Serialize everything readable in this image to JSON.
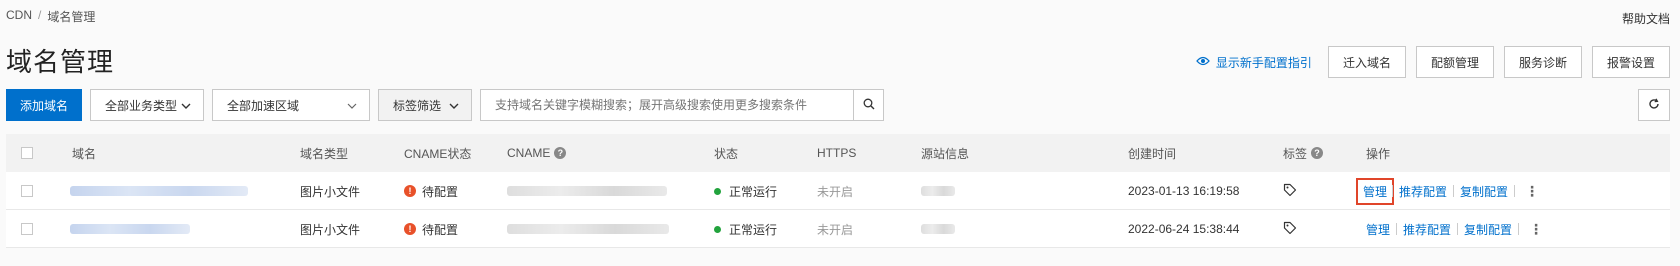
{
  "breadcrumb": {
    "root": "CDN",
    "separator": "/",
    "current": "域名管理"
  },
  "help_label": "帮助文档",
  "page_title": "域名管理",
  "top_actions": {
    "guide_label": "显示新手配置指引",
    "buttons": [
      "迁入域名",
      "配额管理",
      "服务诊断",
      "报警设置"
    ]
  },
  "toolbar": {
    "add_label": "添加域名",
    "business_type": "全部业务类型",
    "region": "全部加速区域",
    "tag_filter": "标签筛选",
    "search_placeholder": "支持域名关键字模糊搜索；展开高级搜索使用更多搜索条件"
  },
  "table": {
    "columns": {
      "domain": "域名",
      "type": "域名类型",
      "cname_status": "CNAME状态",
      "cname": "CNAME",
      "status": "状态",
      "https": "HTTPS",
      "origin": "源站信息",
      "created": "创建时间",
      "tags": "标签",
      "actions": "操作"
    },
    "rows": [
      {
        "type": "图片小文件",
        "cname_status": "待配置",
        "status": "正常运行",
        "https": "未开启",
        "created": "2023-01-13 16:19:58",
        "highlighted": true
      },
      {
        "type": "图片小文件",
        "cname_status": "待配置",
        "status": "正常运行",
        "https": "未开启",
        "created": "2022-06-24 15:38:44",
        "highlighted": false
      }
    ],
    "row_actions": {
      "manage": "管理",
      "recommend": "推荐配置",
      "copy": "复制配置"
    }
  },
  "colors": {
    "primary": "#0070cc",
    "warning": "#e8512a",
    "running": "#22a33d",
    "highlight_box": "#e0452a"
  },
  "icons": [
    "eye-icon",
    "chevron-down-icon",
    "search-icon",
    "refresh-icon",
    "warning-icon",
    "question-icon",
    "tag-icon",
    "more-icon"
  ]
}
